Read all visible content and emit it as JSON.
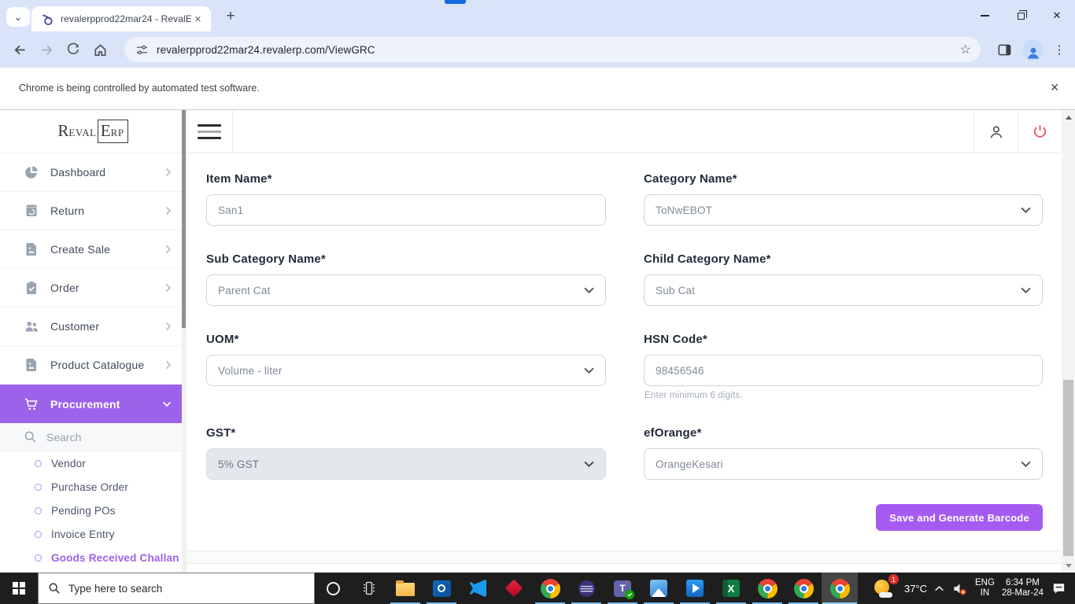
{
  "glyphs": {
    "close": "✕",
    "plus": "+",
    "star": "☆",
    "kebab": "⋮",
    "tab_caret": "⌄",
    "teams_letter": "T",
    "excel_letter": "X",
    "outlook_letter": "O"
  },
  "browser": {
    "tab_title": "revalerpprod22mar24 - RevalE",
    "url": "revalerpprod22mar24.revalerp.com/ViewGRC",
    "notice": "Chrome is being controlled by automated test software."
  },
  "app": {
    "logo": {
      "r": "R",
      "eval": "EVAL",
      "e": "E",
      "rp": "RP"
    }
  },
  "sidebar": {
    "search_placeholder": "Search",
    "items": [
      {
        "label": "Dashboard",
        "icon": "pie-chart-icon"
      },
      {
        "label": "Return",
        "icon": "return-box-icon"
      },
      {
        "label": "Create Sale",
        "icon": "file-image-icon"
      },
      {
        "label": "Order",
        "icon": "clipboard-check-icon"
      },
      {
        "label": "Customer",
        "icon": "people-icon"
      },
      {
        "label": "Product Catalogue",
        "icon": "file-image-icon"
      },
      {
        "label": "Procurement",
        "icon": "cart-icon",
        "active": true
      }
    ],
    "submenu": [
      {
        "label": "Vendor"
      },
      {
        "label": "Purchase Order"
      },
      {
        "label": "Pending POs"
      },
      {
        "label": "Invoice Entry"
      },
      {
        "label": "Goods Received Challan",
        "active": true
      }
    ]
  },
  "form": {
    "fields": [
      {
        "label": "Item Name*",
        "value": "San1",
        "type": "text"
      },
      {
        "label": "Category Name*",
        "value": "ToNwEBOT",
        "type": "select"
      },
      {
        "label": "Sub Category Name*",
        "value": "Parent Cat",
        "type": "select"
      },
      {
        "label": "Child Category Name*",
        "value": "Sub Cat",
        "type": "select"
      },
      {
        "label": "UOM*",
        "value": "Volume - liter",
        "type": "select"
      },
      {
        "label": "HSN Code*",
        "value": "98456546",
        "type": "text",
        "helper": "Enter minimum 6 digits."
      },
      {
        "label": "GST*",
        "value": "5% GST",
        "type": "select",
        "disabled": true
      },
      {
        "label": "efOrange*",
        "value": "OrangeKesari",
        "type": "select"
      }
    ],
    "save_button_label": "Save and Generate Barcode"
  },
  "taskbar": {
    "search_placeholder": "Type here to search",
    "temperature": "37°C",
    "weather_badge": "1",
    "lang_top": "ENG",
    "lang_bottom": "IN",
    "time": "6:34 PM",
    "date": "28-Mar-24"
  },
  "colors": {
    "accent_purple": "#9c62e9",
    "button_purple": "#a55bf0",
    "power_red": "#ee4b4b",
    "taskbar_indicator_blue": "#76b9ed",
    "titlebar_blue": "#d9e4f8"
  }
}
